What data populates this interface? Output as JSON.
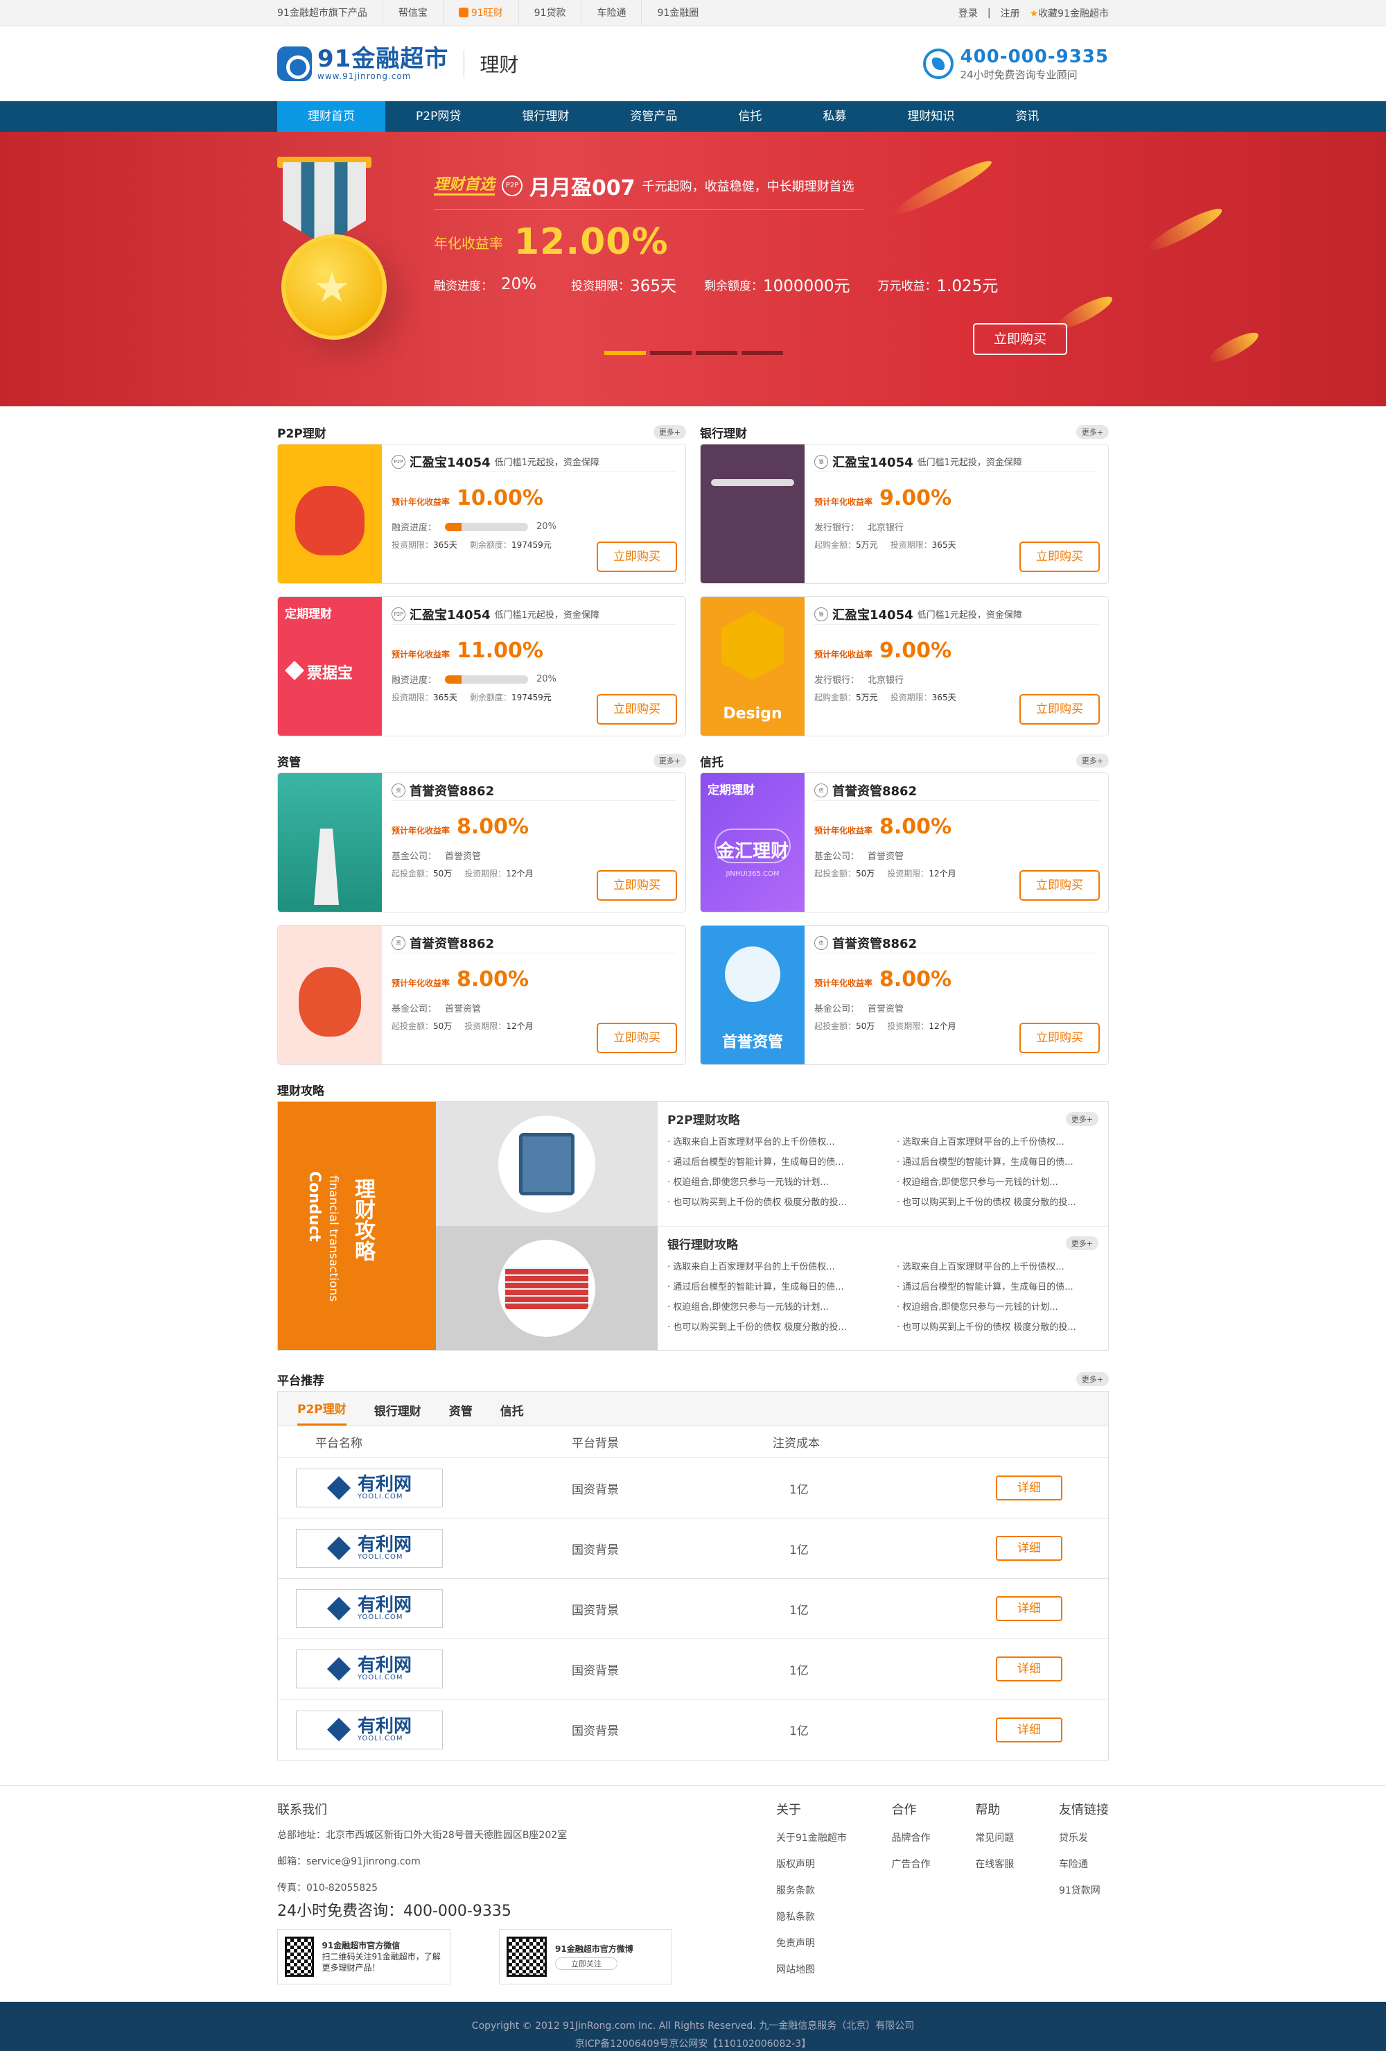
{
  "topbar": {
    "group": "91金融超市旗下产品",
    "products": [
      "帮信宝",
      "91旺财",
      "91贷款",
      "车险通",
      "91金融圈"
    ],
    "login": "登录",
    "sep": "|",
    "register": "注册",
    "favorite": "收藏91金融超市"
  },
  "header": {
    "logo_name": "91金融超市",
    "logo_url": "www.91jinrong.com",
    "section": "理财",
    "hotline": "400-000-9335",
    "hotline_sub": "24小时免费咨询专业顾问"
  },
  "nav": [
    "理财首页",
    "P2P网贷",
    "银行理财",
    "资管产品",
    "信托",
    "私募",
    "理财知识",
    "资讯"
  ],
  "banner": {
    "tag": "理财首选",
    "badge": "P2P",
    "name": "月月盈007",
    "desc": "千元起购，收益稳健，中长期理财首选",
    "rate_label": "年化收益率",
    "rate": "12.00%",
    "progress_label": "融资进度：",
    "progress_value": 0.2,
    "progress_text": "20%",
    "term_label": "投资期限：",
    "term": "365天",
    "remain_label": "剩余额度：",
    "remain": "1000000元",
    "yield_label": "万元收益：",
    "yield": "1.025元",
    "buy": "立即购买",
    "slides": 4,
    "active_slide": 0
  },
  "sections": [
    {
      "title": "P2P理财",
      "more": "更多+",
      "cards": [
        {
          "img": "moneybag-card-image",
          "img_label": "",
          "icon": "P2P",
          "name": "汇盈宝14054",
          "desc": "低门槛1元起投，资金保障",
          "rate_label": "预计年化收益率",
          "rate": "10.00%",
          "l1_label": "融资进度：",
          "progress": 0.2,
          "l1_value": "20%",
          "l2a_label": "投资期限：",
          "l2a": "365天",
          "l2b_label": "剩余额度：",
          "l2b": "197459元",
          "buy": "立即购买"
        },
        {
          "img": "piaojubao-card-image",
          "img_label": "定期理财",
          "img_text": "票据宝",
          "icon": "P2P",
          "name": "汇盈宝14054",
          "desc": "低门槛1元起投，资金保障",
          "rate_label": "预计年化收益率",
          "rate": "11.00%",
          "l1_label": "融资进度：",
          "progress": 0.2,
          "l1_value": "20%",
          "l2a_label": "投资期限：",
          "l2a": "365天",
          "l2b_label": "剩余额度：",
          "l2b": "197459元",
          "buy": "立即购买"
        }
      ]
    },
    {
      "title": "银行理财",
      "more": "更多+",
      "cards": [
        {
          "img": "coin-tray-card-image",
          "img_label": "",
          "icon": "银",
          "name": "汇盈宝14054",
          "desc": "低门槛1元起投，资金保障",
          "rate_label": "预计年化收益率",
          "rate": "9.00%",
          "l1_label": "发行银行：",
          "l1_value": "北京银行",
          "l2a_label": "起购金额：",
          "l2a": "5万元",
          "l2b_label": "投资期限：",
          "l2b": "365天",
          "buy": "立即购买"
        },
        {
          "img": "design-card-image",
          "img_label": "",
          "img_text": "Design",
          "icon": "银",
          "name": "汇盈宝14054",
          "desc": "低门槛1元起投，资金保障",
          "rate_label": "预计年化收益率",
          "rate": "9.00%",
          "l1_label": "发行银行：",
          "l1_value": "北京银行",
          "l2a_label": "起购金额：",
          "l2a": "5万元",
          "l2b_label": "投资期限：",
          "l2b": "365天",
          "buy": "立即购买"
        }
      ]
    },
    {
      "title": "资管",
      "more": "更多+",
      "cards": [
        {
          "img": "windmill-card-image",
          "img_label": "",
          "icon": "资",
          "name": "首誉资管8862",
          "desc": "",
          "rate_label": "预计年化收益率",
          "rate": "8.00%",
          "l1_label": "基金公司：",
          "l1_value": "首誉资管",
          "l2a_label": "起投金额：",
          "l2a": "50万",
          "l2b_label": "投资期限：",
          "l2b": "12个月",
          "buy": "立即购买"
        },
        {
          "img": "luckybag-card-image",
          "img_label": "",
          "icon": "资",
          "name": "首誉资管8862",
          "desc": "",
          "rate_label": "预计年化收益率",
          "rate": "8.00%",
          "l1_label": "基金公司：",
          "l1_value": "首誉资管",
          "l2a_label": "起投金额：",
          "l2a": "50万",
          "l2b_label": "投资期限：",
          "l2b": "12个月",
          "buy": "立即购买"
        }
      ]
    },
    {
      "title": "信托",
      "more": "更多+",
      "cards": [
        {
          "img": "jinhui-card-image",
          "img_label": "定期理财",
          "img_text": "金汇理财",
          "img_sub": "JINHUI365.COM",
          "icon": "信",
          "name": "首誉资管8862",
          "desc": "",
          "rate_label": "预计年化收益率",
          "rate": "8.00%",
          "l1_label": "基金公司：",
          "l1_value": "首誉资管",
          "l2a_label": "起投金额：",
          "l2a": "50万",
          "l2b_label": "投资期限：",
          "l2b": "12个月",
          "buy": "立即购买"
        },
        {
          "img": "umbrella-card-image",
          "img_label": "",
          "img_text": "首誉资管",
          "icon": "信",
          "name": "首誉资管8862",
          "desc": "",
          "rate_label": "预计年化收益率",
          "rate": "8.00%",
          "l1_label": "基金公司：",
          "l1_value": "首誉资管",
          "l2a_label": "起投金额：",
          "l2a": "50万",
          "l2b_label": "投资期限：",
          "l2b": "12个月",
          "buy": "立即购买"
        }
      ]
    }
  ],
  "strategy": {
    "title": "理财攻略",
    "cn": "理财攻略",
    "en1": "Conduct",
    "en2": "financial transactions",
    "lists": [
      {
        "title": "P2P理财攻略",
        "more": "更多+",
        "items": [
          "选取来自上百家理财平台的上千份债权...",
          "选取来自上百家理财平台的上千份债权...",
          "通过后台模型的智能计算，生成每日的债...",
          "通过后台模型的智能计算，生成每日的债...",
          "权迫组合,即使您只参与一元钱的计划...",
          "权迫组合,即使您只参与一元钱的计划...",
          "也可以购买到上千份的债权 极度分散的投...",
          "也可以购买到上千份的债权 极度分散的投..."
        ]
      },
      {
        "title": "银行理财攻略",
        "more": "更多+",
        "items": [
          "选取来自上百家理财平台的上千份债权...",
          "选取来自上百家理财平台的上千份债权...",
          "通过后台模型的智能计算，生成每日的债...",
          "通过后台模型的智能计算，生成每日的债...",
          "权迫组合,即使您只参与一元钱的计划...",
          "权迫组合,即使您只参与一元钱的计划...",
          "也可以购买到上千份的债权 极度分散的投...",
          "也可以购买到上千份的债权 极度分散的投..."
        ]
      }
    ]
  },
  "platform": {
    "title": "平台推荐",
    "more": "更多+",
    "tabs": [
      "P2P理财",
      "银行理财",
      "资管",
      "信托"
    ],
    "headers": [
      "平台名称",
      "平台背景",
      "注资成本"
    ],
    "rows": [
      {
        "logo_cn": "有利网",
        "logo_en": "YOOLI.COM",
        "bg": "国资背景",
        "capital": "1亿",
        "detail": "详细"
      },
      {
        "logo_cn": "有利网",
        "logo_en": "YOOLI.COM",
        "bg": "国资背景",
        "capital": "1亿",
        "detail": "详细"
      },
      {
        "logo_cn": "有利网",
        "logo_en": "YOOLI.COM",
        "bg": "国资背景",
        "capital": "1亿",
        "detail": "详细"
      },
      {
        "logo_cn": "有利网",
        "logo_en": "YOOLI.COM",
        "bg": "国资背景",
        "capital": "1亿",
        "detail": "详细"
      },
      {
        "logo_cn": "有利网",
        "logo_en": "YOOLI.COM",
        "bg": "国资背景",
        "capital": "1亿",
        "detail": "详细"
      }
    ]
  },
  "footer": {
    "contact_title": "联系我们",
    "address": "总部地址：北京市西城区新街口外大街28号普天德胜园区B座202室",
    "email": "邮箱：service@91jinrong.com",
    "fax": "传真：010-82055825",
    "hotline": "24小时免费咨询：400-000-9335",
    "wechat_title": "91金融超市官方微信",
    "wechat_desc": "扫二维码关注91金融超市，了解更多理财产品！",
    "weibo_title": "91金融超市官方微博",
    "weibo_follow": "立即关注",
    "cols": [
      {
        "title": "关于",
        "items": [
          "关于91金融超市",
          "版权声明",
          "服务条款",
          "隐私条款",
          "免责声明",
          "网站地图"
        ]
      },
      {
        "title": "合作",
        "items": [
          "品牌合作",
          "广告合作"
        ]
      },
      {
        "title": "帮助",
        "items": [
          "常见问题",
          "在线客服"
        ]
      },
      {
        "title": "友情链接",
        "items": [
          "贷乐发",
          "车险通",
          "91贷款网"
        ]
      }
    ],
    "copyright": "Copyright © 2012 91JinRong.com Inc. All Rights Reserved. 九一金融信息服务（北京）有限公司",
    "icp": "京ICP备12006409号京公网安【110102006082-3】"
  },
  "colors": {
    "accent": "#f07800",
    "nav": "#0c4e76",
    "nav_active": "#0b98e4",
    "banner": "#d93038",
    "footer": "#153f60"
  }
}
